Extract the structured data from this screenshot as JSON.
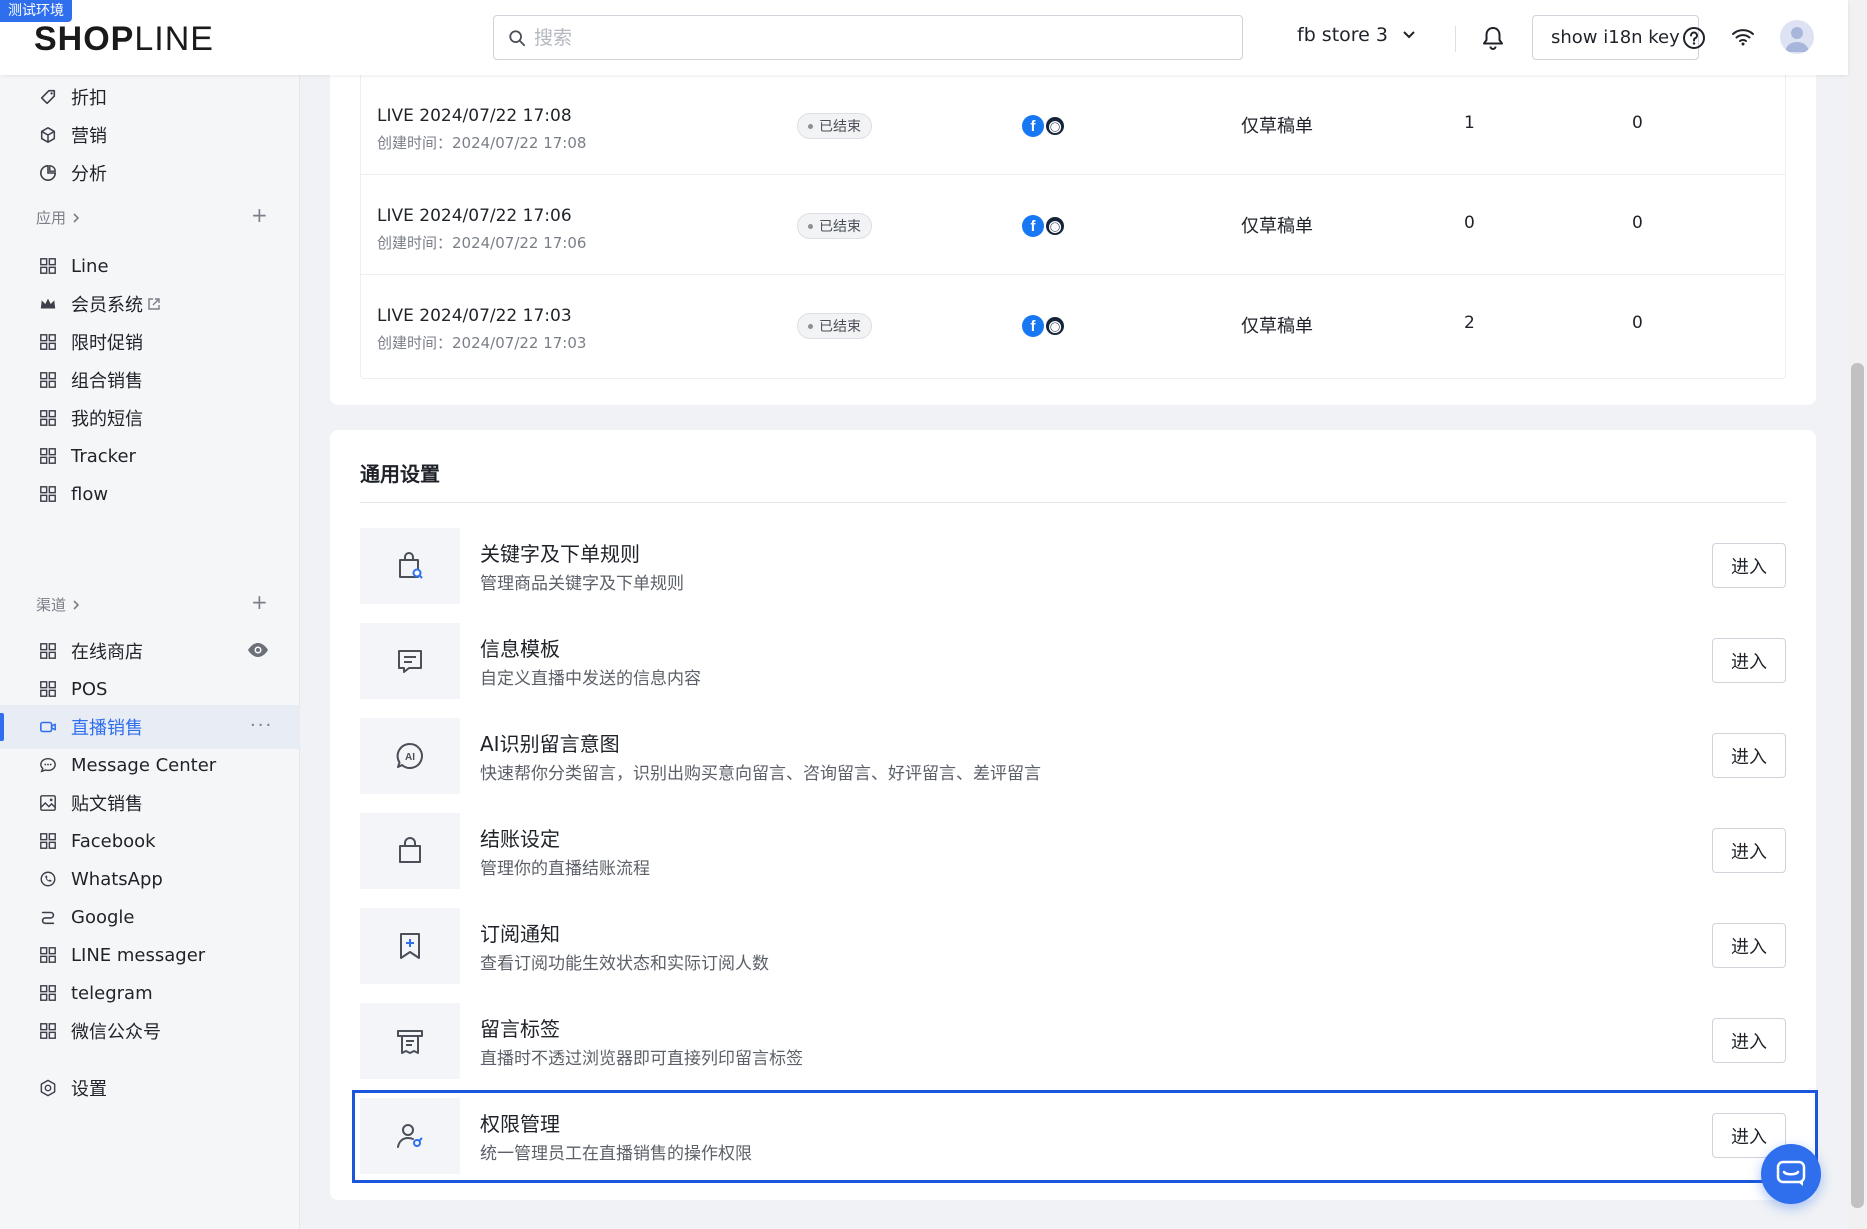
{
  "env_badge": "测试环境",
  "logo": {
    "bold": "SHOP",
    "light": "LINE"
  },
  "header": {
    "search_placeholder": "搜索",
    "store_name": "fb store 3",
    "i18n_button": "show i18n key"
  },
  "sidebar": {
    "top_items": [
      {
        "label": "折扣",
        "icon": "tag-icon"
      },
      {
        "label": "营销",
        "icon": "cube-icon"
      },
      {
        "label": "分析",
        "icon": "pie-chart-icon"
      }
    ],
    "apps_group": "应用",
    "app_items": [
      {
        "label": "Line",
        "icon": "apps-grid-icon"
      },
      {
        "label": "会员系统",
        "icon": "crown-icon"
      },
      {
        "label": "限时促销",
        "icon": "apps-grid-icon"
      },
      {
        "label": "组合销售",
        "icon": "apps-grid-icon"
      },
      {
        "label": "我的短信",
        "icon": "apps-grid-icon"
      },
      {
        "label": "Tracker",
        "icon": "apps-grid-icon"
      },
      {
        "label": "flow",
        "icon": "apps-grid-icon"
      }
    ],
    "channels_group": "渠道",
    "channel_items": [
      {
        "label": "在线商店",
        "icon": "apps-grid-icon"
      },
      {
        "label": "POS",
        "icon": "apps-grid-icon"
      },
      {
        "label": "直播销售",
        "icon": "live-camera-icon",
        "active": true
      },
      {
        "label": "Message Center",
        "icon": "chat-icon"
      },
      {
        "label": "贴文销售",
        "icon": "image-icon"
      },
      {
        "label": "Facebook",
        "icon": "apps-grid-icon"
      },
      {
        "label": "WhatsApp",
        "icon": "whatsapp-icon"
      },
      {
        "label": "Google",
        "icon": "google-icon"
      },
      {
        "label": "LINE messager",
        "icon": "apps-grid-icon"
      },
      {
        "label": "telegram",
        "icon": "apps-grid-icon"
      },
      {
        "label": "微信公众号",
        "icon": "apps-grid-icon"
      }
    ],
    "settings": "设置",
    "active_color": "#2f6fed"
  },
  "live_table": {
    "rows": [
      {
        "title": "LIVE 2024/07/22 17:08",
        "created": "创建时间：2024/07/22 17:08",
        "status": "已结束",
        "mode": "仅草稿单",
        "count1": "1",
        "count2": "0"
      },
      {
        "title": "LIVE 2024/07/22 17:06",
        "created": "创建时间：2024/07/22 17:06",
        "status": "已结束",
        "mode": "仅草稿单",
        "count1": "0",
        "count2": "0"
      },
      {
        "title": "LIVE 2024/07/22 17:03",
        "created": "创建时间：2024/07/22 17:03",
        "status": "已结束",
        "mode": "仅草稿单",
        "count1": "2",
        "count2": "0"
      }
    ]
  },
  "general_settings": {
    "title": "通用设置",
    "enter_label": "进入",
    "items": [
      {
        "name": "关键字及下单规则",
        "desc": "管理商品关键字及下单规则",
        "icon": "bag-search-icon"
      },
      {
        "name": "信息模板",
        "desc": "自定义直播中发送的信息内容",
        "icon": "message-template-icon"
      },
      {
        "name": "AI识别留言意图",
        "desc": "快速帮你分类留言，识别出购买意向留言、咨询留言、好评留言、差评留言",
        "icon": "ai-chat-icon"
      },
      {
        "name": "结账设定",
        "desc": "管理你的直播结账流程",
        "icon": "shopping-bag-icon"
      },
      {
        "name": "订阅通知",
        "desc": "查看订阅功能生效状态和实际订阅人数",
        "icon": "bookmark-plus-icon"
      },
      {
        "name": "留言标签",
        "desc": "直播时不透过浏览器即可直接列印留言标签",
        "icon": "printer-icon"
      },
      {
        "name": "权限管理",
        "desc": "统一管理员工在直播销售的操作权限",
        "icon": "user-permission-icon"
      }
    ]
  }
}
